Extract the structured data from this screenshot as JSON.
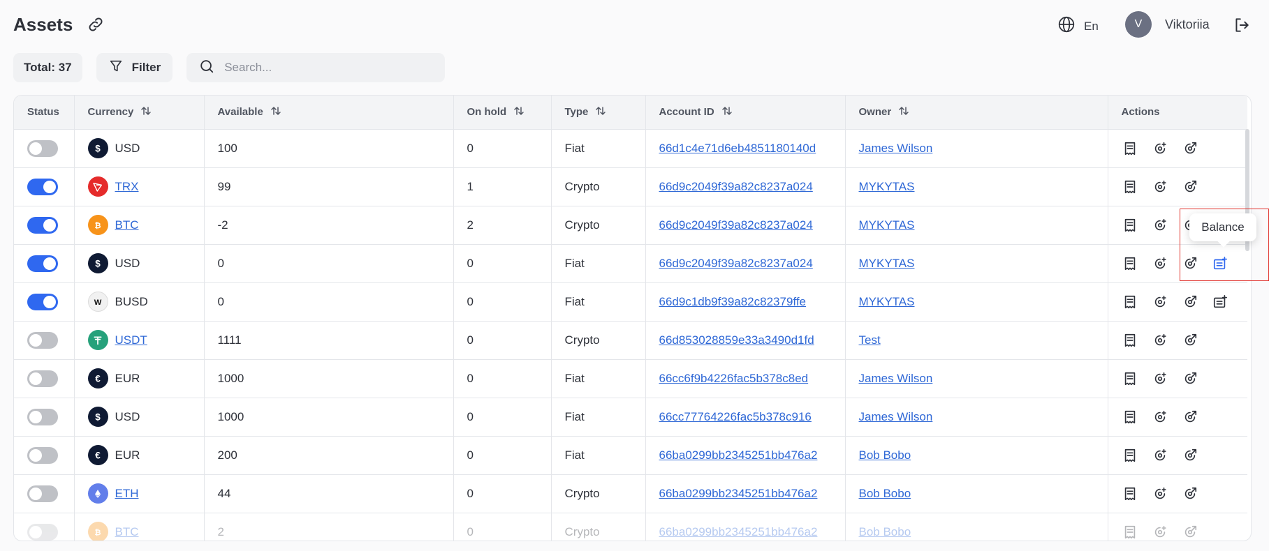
{
  "header": {
    "title": "Assets",
    "language": "En",
    "user_initial": "V",
    "user_name": "Viktoriia"
  },
  "toolbar": {
    "total": "Total: 37",
    "filter_label": "Filter",
    "search_placeholder": "Search..."
  },
  "table": {
    "columns": [
      {
        "label": "Status",
        "sortable": false
      },
      {
        "label": "Currency",
        "sortable": true
      },
      {
        "label": "Available",
        "sortable": true
      },
      {
        "label": "On hold",
        "sortable": true
      },
      {
        "label": "Type",
        "sortable": true
      },
      {
        "label": "Account ID",
        "sortable": true
      },
      {
        "label": "Owner",
        "sortable": true
      },
      {
        "label": "Actions",
        "sortable": false
      }
    ],
    "rows": [
      {
        "status": false,
        "currency": "USD",
        "currency_link": false,
        "icon": "usd",
        "available": "100",
        "on_hold": "0",
        "type": "Fiat",
        "account_id": "66d1c4e71d6eb4851180140d",
        "owner": "James Wilson",
        "balance_action": false
      },
      {
        "status": true,
        "currency": "TRX",
        "currency_link": true,
        "icon": "trx",
        "available": "99",
        "on_hold": "1",
        "type": "Crypto",
        "account_id": "66d9c2049f39a82c8237a024",
        "owner": "MYKYTAS",
        "balance_action": false
      },
      {
        "status": true,
        "currency": "BTC",
        "currency_link": true,
        "icon": "btc",
        "available": "-2",
        "on_hold": "2",
        "type": "Crypto",
        "account_id": "66d9c2049f39a82c8237a024",
        "owner": "MYKYTAS",
        "balance_action": false
      },
      {
        "status": true,
        "currency": "USD",
        "currency_link": false,
        "icon": "usd",
        "available": "0",
        "on_hold": "0",
        "type": "Fiat",
        "account_id": "66d9c2049f39a82c8237a024",
        "owner": "MYKYTAS",
        "balance_action": true,
        "balance_active": true
      },
      {
        "status": true,
        "currency": "BUSD",
        "currency_link": false,
        "icon": "busd",
        "available": "0",
        "on_hold": "0",
        "type": "Fiat",
        "account_id": "66d9c1db9f39a82c82379ffe",
        "owner": "MYKYTAS",
        "balance_action": true
      },
      {
        "status": false,
        "currency": "USDT",
        "currency_link": true,
        "icon": "usdt",
        "available": "1111",
        "on_hold": "0",
        "type": "Crypto",
        "account_id": "66d853028859e33a3490d1fd",
        "owner": "Test",
        "balance_action": false
      },
      {
        "status": false,
        "currency": "EUR",
        "currency_link": false,
        "icon": "eur",
        "available": "1000",
        "on_hold": "0",
        "type": "Fiat",
        "account_id": "66cc6f9b4226fac5b378c8ed",
        "owner": "James Wilson",
        "balance_action": false
      },
      {
        "status": false,
        "currency": "USD",
        "currency_link": false,
        "icon": "usd",
        "available": "1000",
        "on_hold": "0",
        "type": "Fiat",
        "account_id": "66cc77764226fac5b378c916",
        "owner": "James Wilson",
        "balance_action": false
      },
      {
        "status": false,
        "currency": "EUR",
        "currency_link": false,
        "icon": "eur",
        "available": "200",
        "on_hold": "0",
        "type": "Fiat",
        "account_id": "66ba0299bb2345251bb476a2",
        "owner": "Bob Bobo",
        "balance_action": false
      },
      {
        "status": false,
        "currency": "ETH",
        "currency_link": true,
        "icon": "eth",
        "available": "44",
        "on_hold": "0",
        "type": "Crypto",
        "account_id": "66ba0299bb2345251bb476a2",
        "owner": "Bob Bobo",
        "balance_action": false
      },
      {
        "status": false,
        "currency": "BTC",
        "currency_link": true,
        "icon": "btc",
        "available": "2",
        "on_hold": "0",
        "type": "Crypto",
        "account_id": "66ba0299bb2345251bb476a2",
        "owner": "Bob Bobo",
        "balance_action": false,
        "faded": true
      }
    ]
  },
  "tooltip": {
    "text": "Balance"
  },
  "icon_colors": {
    "usd": "#0f1a33",
    "eur": "#0f1a33",
    "trx": "#e52b2b",
    "btc": "#f7931a",
    "busd": "#f1f1f1",
    "usdt": "#26a17b",
    "eth": "#627eea"
  },
  "accent": "#2f68f0",
  "link_color": "#2f68d6"
}
